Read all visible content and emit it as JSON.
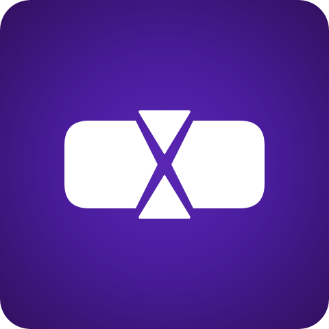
{
  "icon": {
    "name": "app-logo-icon",
    "background_center_color": "#5a27b5",
    "background_edge_color": "#32105f",
    "glyph_color": "#ffffff"
  }
}
